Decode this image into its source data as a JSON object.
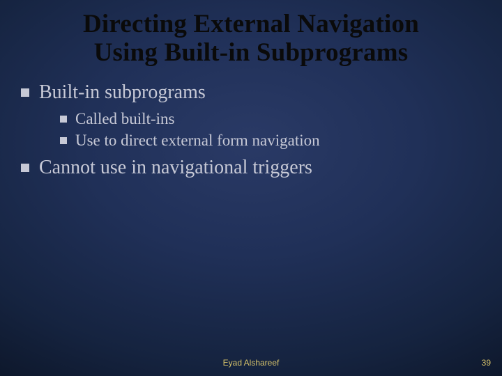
{
  "title_line1": "Directing External Navigation",
  "title_line2": "Using Built-in Subprograms",
  "bullets": {
    "l1_a": "Built-in subprograms",
    "l2_a": "Called built-ins",
    "l2_b": "Use to direct external form navigation",
    "l1_b": "Cannot use in navigational triggers"
  },
  "footer": {
    "author": "Eyad Alshareef",
    "page": "39"
  }
}
